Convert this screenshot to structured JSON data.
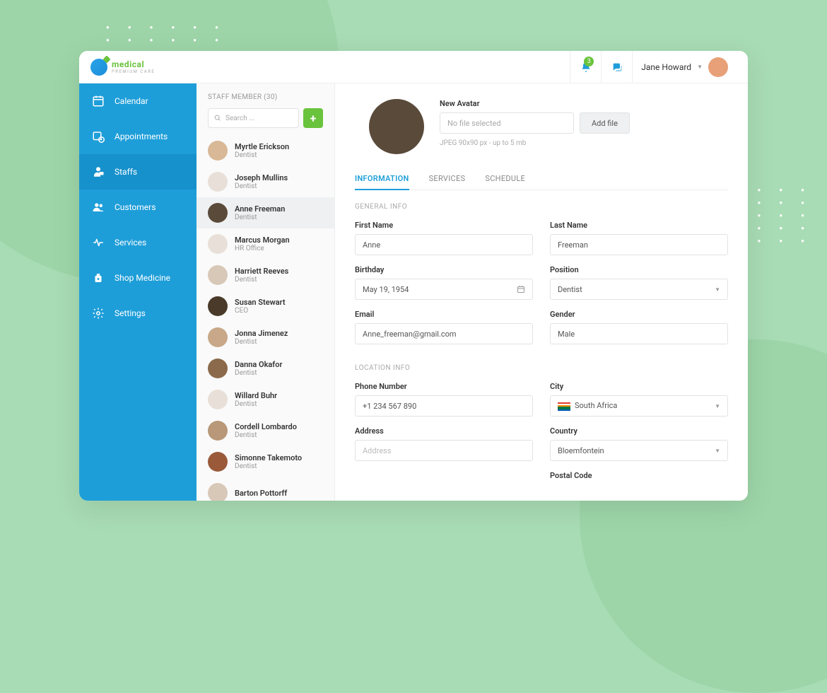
{
  "brand": {
    "name": "medical",
    "sub": "PREMIUM CARE"
  },
  "topbar": {
    "notification_count": "3",
    "user_name": "Jane Howard"
  },
  "sidebar": {
    "items": [
      {
        "label": "Calendar"
      },
      {
        "label": "Appointments"
      },
      {
        "label": "Staffs"
      },
      {
        "label": "Customers"
      },
      {
        "label": "Services"
      },
      {
        "label": "Shop Medicine"
      },
      {
        "label": "Settings"
      }
    ]
  },
  "stafflist": {
    "header": "STAFF MEMBER (30)",
    "search_placeholder": "Search ...",
    "items": [
      {
        "name": "Myrtle Erickson",
        "role": "Dentist",
        "bg": "#d8b896"
      },
      {
        "name": "Joseph Mullins",
        "role": "Dentist",
        "bg": "#e8e0d8"
      },
      {
        "name": "Anne Freeman",
        "role": "Dentist",
        "bg": "#5a4a3a",
        "selected": true
      },
      {
        "name": "Marcus Morgan",
        "role": "HR Office",
        "bg": "#e8e0d8"
      },
      {
        "name": "Harriett Reeves",
        "role": "Dentist",
        "bg": "#d8c8b8"
      },
      {
        "name": "Susan Stewart",
        "role": "CEO",
        "bg": "#4a3a2a"
      },
      {
        "name": "Jonna Jimenez",
        "role": "Dentist",
        "bg": "#c8a888"
      },
      {
        "name": "Danna Okafor",
        "role": "Dentist",
        "bg": "#8a6a4a"
      },
      {
        "name": "Willard Buhr",
        "role": "Dentist",
        "bg": "#e8e0d8"
      },
      {
        "name": "Cordell Lombardo",
        "role": "Dentist",
        "bg": "#b89878"
      },
      {
        "name": "Simonne Takemoto",
        "role": "Dentist",
        "bg": "#9a5a3a"
      },
      {
        "name": "Barton Pottorff",
        "role": "",
        "bg": "#d8c8b8"
      }
    ]
  },
  "profile": {
    "avatar_label": "New Avatar",
    "file_placeholder": "No file selected",
    "add_file": "Add file",
    "hint": "JPEG 90x90 px - up to 5 mb"
  },
  "tabs": [
    {
      "label": "INFORMATION"
    },
    {
      "label": "SERVICES"
    },
    {
      "label": "SCHEDULE"
    }
  ],
  "sections": {
    "general": "GENERAL INFO",
    "location": "LOCATION INFO"
  },
  "form": {
    "first_name": {
      "label": "First Name",
      "value": "Anne"
    },
    "last_name": {
      "label": "Last Name",
      "value": "Freeman"
    },
    "birthday": {
      "label": "Birthday",
      "value": "May 19, 1954"
    },
    "position": {
      "label": "Position",
      "value": "Dentist"
    },
    "email": {
      "label": "Email",
      "value": "Anne_freeman@gmail.com"
    },
    "gender": {
      "label": "Gender",
      "value": "Male"
    },
    "phone": {
      "label": "Phone Number",
      "value": "+1 234 567 890"
    },
    "city": {
      "label": "City",
      "value": "South Africa"
    },
    "address": {
      "label": "Address",
      "placeholder": "Address"
    },
    "country": {
      "label": "Country",
      "value": "Bloemfontein"
    },
    "postal": {
      "label": "Postal Code"
    }
  }
}
